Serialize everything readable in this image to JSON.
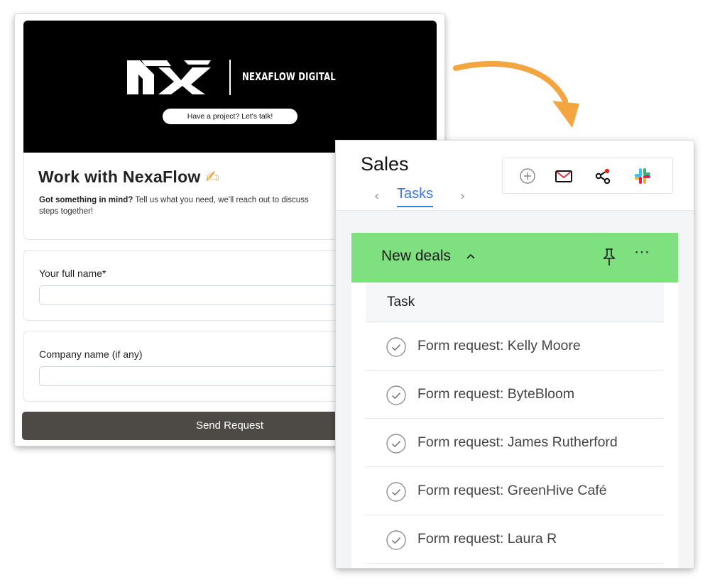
{
  "form": {
    "brand_name": "NEXAFLOW DIGITAL",
    "cta_label": "Have a project? Let's talk!",
    "title": "Work with NexaFlow",
    "title_emoji": "✍",
    "intro_bold": "Got something in mind?",
    "intro_text": " Tell us what you need, we'll reach out to discuss",
    "intro_text_2": "steps together!",
    "fields": [
      {
        "label": "Your full name*",
        "value": "",
        "placeholder": ""
      },
      {
        "label": "Company name (if any)",
        "value": "",
        "placeholder": ""
      }
    ],
    "submit_label": "Send Request"
  },
  "crm": {
    "title": "Sales",
    "active_tab": "Tasks",
    "group": {
      "name": "New deals"
    },
    "column_header": "Task",
    "tasks": [
      "Form request: Kelly Moore",
      "Form request: ByteBloom",
      "Form request: James Rutherford",
      "Form request: GreenHive Café",
      "Form request: Laura R"
    ]
  },
  "icons": [
    "add-icon",
    "mail-icon",
    "share-icon",
    "slack-icon",
    "pin-icon",
    "more-icon",
    "check-circle-icon",
    "chevron-up-icon",
    "chevron-left-icon",
    "chevron-right-icon"
  ],
  "colors": {
    "banner": "#000000",
    "submit_button": "#4d4a45",
    "group_header": "#7ee07f",
    "tab_accent": "#3c78d8",
    "arrow": "#f3a540",
    "mail_icon": "#d9343a"
  }
}
